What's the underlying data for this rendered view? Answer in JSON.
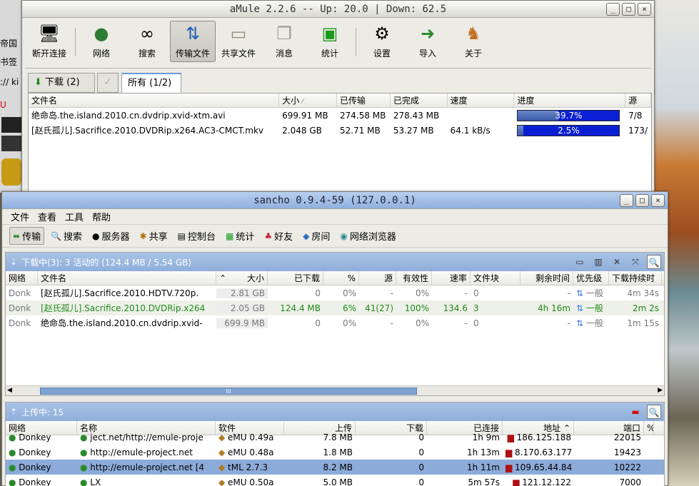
{
  "colors": {
    "progress_bar": "#0a1fd4",
    "panel_header": "#9bb8df",
    "selected_row": "#8cabd9",
    "green_text": "#1e8a18"
  },
  "leftstrip": {
    "lines": [
      "帝国",
      "书签",
      ":// ki",
      "U"
    ]
  },
  "amule": {
    "title": "aMule 2.2.6 -- Up: 20.0 | Down: 62.5",
    "window_buttons": [
      "_",
      "□",
      "×"
    ],
    "toolbar": [
      {
        "label": "断开连接",
        "icon": "disconnect-icon"
      },
      {
        "label": "网络",
        "icon": "globe-icon"
      },
      {
        "label": "搜索",
        "icon": "binoculars-icon"
      },
      {
        "label": "传输文件",
        "icon": "transfer-arrows-icon"
      },
      {
        "label": "共享文件",
        "icon": "folder-icon"
      },
      {
        "label": "消息",
        "icon": "chat-bubbles-icon"
      },
      {
        "label": "统计",
        "icon": "graph-icon"
      },
      {
        "label": "设置",
        "icon": "settings-icon"
      },
      {
        "label": "导入",
        "icon": "import-icon"
      },
      {
        "label": "关于",
        "icon": "mule-icon"
      }
    ],
    "tabs": {
      "download": "下载 (2)",
      "all": "所有 (1/2)"
    },
    "columns": [
      "文件名",
      "大小",
      "已传输",
      "已完成",
      "速度",
      "进度",
      "源"
    ],
    "rows": [
      {
        "name": "绝命岛.the.island.2010.cn.dvdrip.xvid-xtm.avi",
        "size": "699.91 MB",
        "transferred": "274.58 MB",
        "completed": "278.43 MB",
        "speed": "",
        "progress": "39.7%",
        "progress_value": 0.397,
        "sources": "7/8"
      },
      {
        "name": "[赵氏孤儿].Sacrifice.2010.DVDRip.x264.AC3-CMCT.mkv",
        "size": "2.048 GB",
        "transferred": "52.71 MB",
        "completed": "53.27 MB",
        "speed": "64.1 kB/s",
        "progress": "2.5%",
        "progress_value": 0.025,
        "sources": "173/"
      }
    ]
  },
  "sancho": {
    "title": "sancho 0.9.4-59 (127.0.0.1)",
    "window_buttons": [
      "_",
      "□",
      "×"
    ],
    "menu": [
      "文件",
      "查看",
      "工具",
      "帮助"
    ],
    "toolbar": [
      {
        "label": "传输",
        "icon": "transfer-icon"
      },
      {
        "label": "搜索",
        "icon": "search-icon"
      },
      {
        "label": "服务器",
        "icon": "server-icon"
      },
      {
        "label": "共享",
        "icon": "share-icon"
      },
      {
        "label": "控制台",
        "icon": "console-icon"
      },
      {
        "label": "统计",
        "icon": "stats-icon"
      },
      {
        "label": "好友",
        "icon": "friends-icon"
      },
      {
        "label": "房间",
        "icon": "rooms-icon"
      },
      {
        "label": "网络浏览器",
        "icon": "browser-icon"
      }
    ],
    "downloads": {
      "header": "下载中(3): 3 活动的 (124.4 MB / 5.54 GB)",
      "columns": [
        "网络",
        "文件名",
        "大小",
        "已下载",
        "%",
        "源",
        "有效性",
        "速率",
        "文件块",
        "剩余时间",
        "优先级",
        "下载持续时"
      ],
      "rows": [
        {
          "net": "Donk",
          "name": "[赵氏孤儿].Sacrifice.2010.HDTV.720p.",
          "size": "2.81 GB",
          "downloaded": "0",
          "pct": "0%",
          "src": "-",
          "avail": "0%",
          "rate": "-",
          "chunks": "0",
          "eta": "-",
          "prio": "一般",
          "dur": "4m 34s"
        },
        {
          "net": "Donk",
          "name": "[赵氏孤儿].Sacrifice.2010.DVDRip.x264",
          "size": "2.05 GB",
          "downloaded": "124.4 MB",
          "pct": "6%",
          "src": "41(27)",
          "avail": "100%",
          "rate": "134.6",
          "chunks": "3",
          "eta": "4h 16m",
          "prio": "一般",
          "dur": "2m 2s"
        },
        {
          "net": "Donk",
          "name": "绝命岛.the.island.2010.cn.dvdrip.xvid-",
          "size": "699.9 MB",
          "downloaded": "0",
          "pct": "0%",
          "src": "-",
          "avail": "0%",
          "rate": "-",
          "chunks": "0",
          "eta": "-",
          "prio": "一般",
          "dur": "1m 15s"
        }
      ],
      "scroll_label": "III"
    },
    "uploads": {
      "header": "上传中: 15",
      "columns": [
        "网络",
        "名称",
        "软件",
        "上传",
        "下载",
        "已连接",
        "地址",
        "端口",
        "%"
      ],
      "rows": [
        {
          "net": "Donkey",
          "name": "ject.net/http://emule-proje",
          "soft": "eMU 0.49a",
          "up": "7.8 MB",
          "down": "0",
          "conn": "1h 9m",
          "addr": "186.125.188",
          "port": "22015"
        },
        {
          "net": "Donkey",
          "name": "http://emule-project.net",
          "soft": "eMU 0.48a",
          "up": "1.8 MB",
          "down": "0",
          "conn": "1h 13m",
          "addr": "8.170.63.177",
          "port": "19423"
        },
        {
          "net": "Donkey",
          "name": "http://emule-project.net [4",
          "soft": "tML 2.7.3",
          "up": "8.2 MB",
          "down": "0",
          "conn": "1h 11m",
          "addr": "109.65.44.84",
          "port": "10222"
        },
        {
          "net": "Donkey",
          "name": "LX",
          "soft": "eMU 0.50a",
          "up": "5.0 MB",
          "down": "0",
          "conn": "5m 57s",
          "addr": "121.12.122",
          "port": "7000"
        }
      ]
    }
  }
}
